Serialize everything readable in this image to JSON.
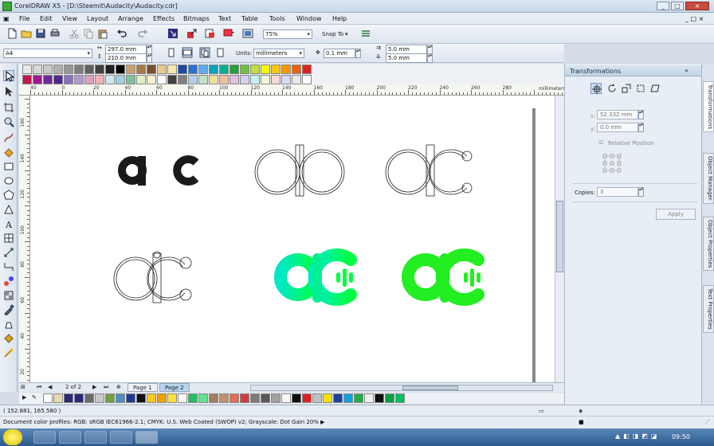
{
  "window": {
    "title": "CorelDRAW X5 - [D:\\Steemit\\Audacity\\Audacity.cdr]",
    "min_label": "_",
    "max_label": "□",
    "close_label": "×"
  },
  "menu": [
    "File",
    "Edit",
    "View",
    "Layout",
    "Arrange",
    "Effects",
    "Bitmaps",
    "Text",
    "Table",
    "Tools",
    "Window",
    "Help"
  ],
  "standard_toolbar": {
    "zoom_value": "75%",
    "snap_to_label": "Snap To"
  },
  "property_bar": {
    "paper_size": "A4",
    "width": "297.0 mm",
    "height": "210.0 mm",
    "units_label": "Units:",
    "units_value": "millimeters",
    "nudge": "0.1 mm",
    "dup_x": "5.0 mm",
    "dup_y": "5.0 mm"
  },
  "palette_colors_top": [
    "#e8e8e8",
    "#d8d8d8",
    "#c8c8c8",
    "#b0b0b0",
    "#989898",
    "#7d7d7d",
    "#606060",
    "#404040",
    "#202020",
    "#000000",
    "#c8a06e",
    "#a87a4a",
    "#7a5030",
    "#e8c890",
    "#f8e8b0",
    "#1848a8",
    "#2870d0",
    "#60a8f0",
    "#00a0c0",
    "#00b090",
    "#20a040",
    "#70c040",
    "#c0e040",
    "#f8f800",
    "#f8c800",
    "#f89800",
    "#f06010",
    "#e02020",
    "#c01850",
    "#a01890",
    "#702898",
    "#502890",
    "#8870c0",
    "#b098d0",
    "#e0a0c0",
    "#f0b0b0",
    "#d0e8f0",
    "#a0d0e0",
    "#80c0a0",
    "#e0f0c0",
    "#f8f0d0",
    "#ffffff",
    "#404040",
    "#808080",
    "#b0d0e8",
    "#c0e0c0",
    "#f0e0a0",
    "#f0c0a0",
    "#e0c0e0",
    "#d0d0f0",
    "#c8f0f0",
    "#f0f8d8",
    "#f8d8d8",
    "#d8d8f8",
    "#e8e8e8",
    "#ffffff"
  ],
  "palette_colors_bottom": [
    "#ffffff",
    "#e8d8b0",
    "#2a2a78",
    "#282878",
    "#6a6a6a",
    "#c8c8c8",
    "#70a040",
    "#4a90c0",
    "#203890",
    "#101010",
    "#f8c820",
    "#f0a000",
    "#f8e040",
    "#f8f8f8",
    "#20c060",
    "#60e090",
    "#a08060",
    "#c09070",
    "#e07050",
    "#c84040",
    "#7a7a7a",
    "#585858",
    "#a0a0a0",
    "#f8f8f8",
    "#101010",
    "#e02020",
    "#c0c0c0",
    "#f8e000",
    "#2040a0",
    "#10a0e0",
    "#20b040",
    "#f0f0f0",
    "#101010",
    "#00a040",
    "#00c060"
  ],
  "canvas": {
    "page_tabs": [
      "Page 1",
      "Page 2"
    ],
    "page_counter": "2 of 2",
    "h_ruler_labels": [
      "40",
      "0",
      "20",
      "40",
      "60",
      "80",
      "100",
      "120",
      "140",
      "160",
      "180",
      "200",
      "220",
      "240",
      "260",
      "280"
    ],
    "h_ruler_units": "millimeters",
    "v_ruler_labels": [
      "160",
      "140",
      "120",
      "100",
      "80",
      "60",
      "40",
      "20"
    ],
    "glyph_a": "a",
    "glyph_c": "c",
    "gradient_colors": [
      "#00e8c8",
      "#00ff40"
    ],
    "solid_green": "#22ee22"
  },
  "docker": {
    "title": "Transformations",
    "x_value": "52.332 mm",
    "y_value": "0.0 mm",
    "relative_position_label": "Relative Position",
    "copies_label": "Copies:",
    "copies_value": "3",
    "apply_label": "Apply",
    "tabs": [
      "Transformations",
      "Object Manager",
      "Object Properties",
      "Text Properties"
    ]
  },
  "status": {
    "cursor_position": "( 152.881, 165.580 )",
    "color_profiles": "Document color profiles: RGB: sRGB IEC61966-2.1; CMYK: U.S. Web Coated (SWOP) v2; Grayscale: Dot Gain 20% ▶"
  },
  "taskbar": {
    "clock": "09:50"
  }
}
